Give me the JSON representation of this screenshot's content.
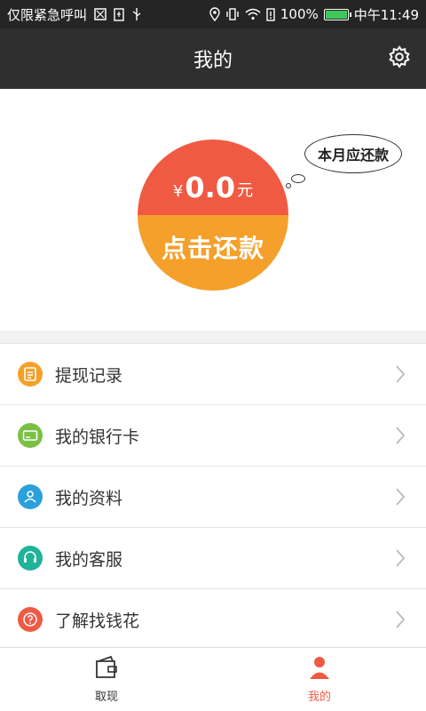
{
  "status_bar": {
    "carrier": "仅限紧急呼叫",
    "battery_percent": "100%",
    "time": "中午11:49"
  },
  "header": {
    "title": "我的"
  },
  "repayment": {
    "currency": "¥",
    "amount": "0.0",
    "unit": "元",
    "button_label": "点击还款",
    "bubble_text": "本月应还款"
  },
  "menu": {
    "items": [
      {
        "label": "提现记录",
        "icon": "clipboard-icon",
        "color": "#f4a02a"
      },
      {
        "label": "我的银行卡",
        "icon": "bank-card-icon",
        "color": "#7bc043"
      },
      {
        "label": "我的资料",
        "icon": "profile-icon",
        "color": "#2aa1dc"
      },
      {
        "label": "我的客服",
        "icon": "headset-icon",
        "color": "#1fb39a"
      },
      {
        "label": "了解找钱花",
        "icon": "question-icon",
        "color": "#ef5a43"
      }
    ]
  },
  "bottom_nav": {
    "items": [
      {
        "label": "取现",
        "icon": "wallet-icon"
      },
      {
        "label": "我的",
        "icon": "user-icon"
      }
    ]
  },
  "colors": {
    "header_bg": "#2f2f2f",
    "circle_top": "#f05a43",
    "circle_bottom": "#f4a02a"
  }
}
